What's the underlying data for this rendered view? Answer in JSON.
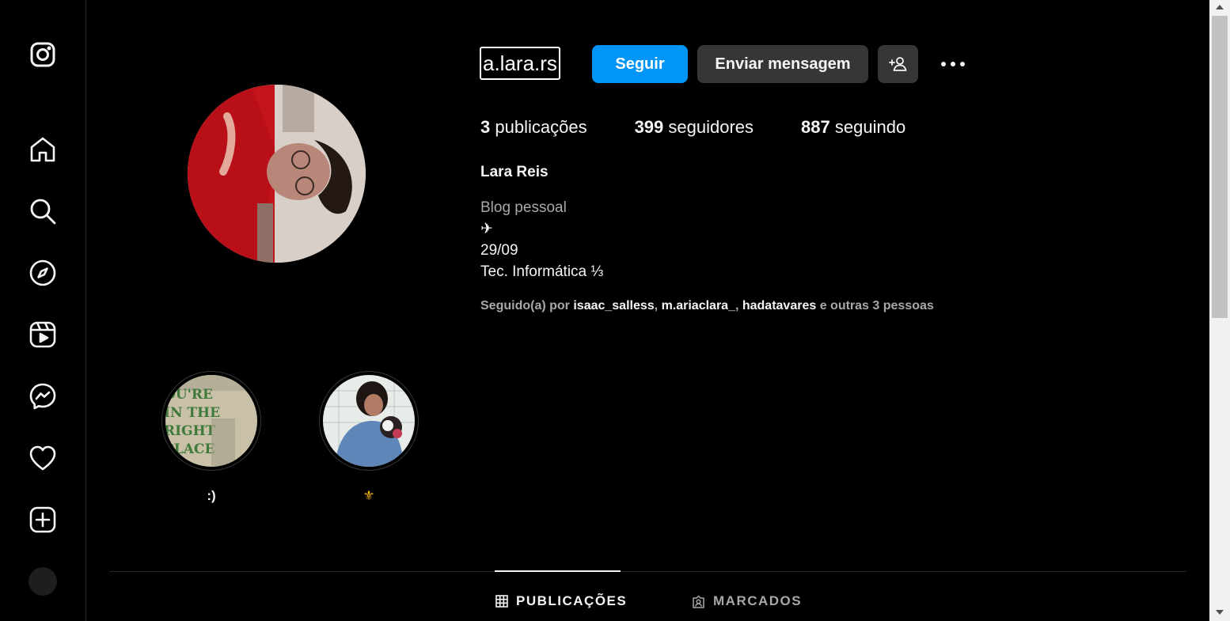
{
  "profile": {
    "username": "a.lara.rs",
    "follow_label": "Seguir",
    "message_label": "Enviar mensagem",
    "stats": {
      "posts_count": "3",
      "posts_label": "publicações",
      "followers_count": "399",
      "followers_label": "seguidores",
      "following_count": "887",
      "following_label": "seguindo"
    },
    "full_name": "Lara Reis",
    "category": "Blog pessoal",
    "bio": [
      "✈",
      "29/09",
      "Tec. Informática ⅓"
    ],
    "followed_by": {
      "prefix": "Seguido(a) por",
      "accounts": [
        "isaac_salless",
        "m.ariaclara_",
        "hadatavares"
      ],
      "suffix": "e outras 3 pessoas"
    }
  },
  "highlights": [
    {
      "label": ":)",
      "image_text": "OU'RE IN THE RIGHT PLACE"
    },
    {
      "label": "⚜"
    }
  ],
  "tabs": [
    {
      "label": "PUBLICAÇÕES",
      "active": true,
      "icon": "grid-icon"
    },
    {
      "label": "MARCADOS",
      "active": false,
      "icon": "tagged-icon"
    }
  ],
  "sidebar": {
    "items": [
      "instagram-logo-icon",
      "home-icon",
      "search-icon",
      "explore-icon",
      "reels-icon",
      "messenger-icon",
      "notifications-heart-icon",
      "create-icon",
      "profile-avatar"
    ]
  },
  "colors": {
    "accent": "#0095f6",
    "background": "#000000",
    "button_secondary": "#363636",
    "muted_text": "#a8a8a8",
    "highlight_label_2": "#f0b21a"
  }
}
